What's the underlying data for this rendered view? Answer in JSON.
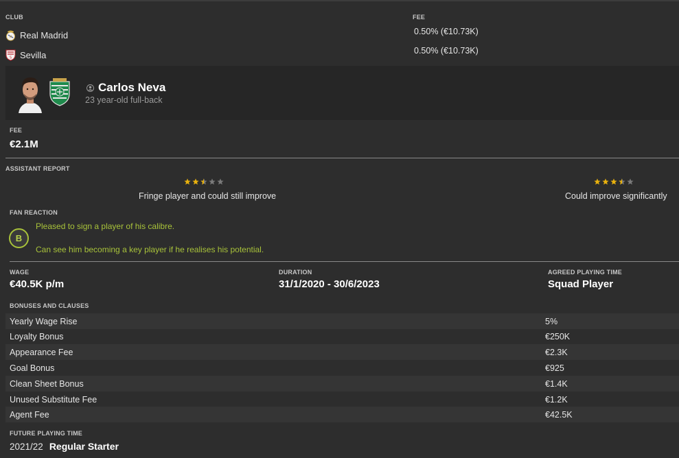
{
  "clubs_section": {
    "club_label": "CLUB",
    "fee_label": "FEE",
    "rows": [
      {
        "club": "Real Madrid",
        "fee": "0.50% (€10.73K)"
      },
      {
        "club": "Sevilla",
        "fee": "0.50% (€10.73K)"
      }
    ]
  },
  "player": {
    "name": "Carlos Neva",
    "description": "23 year-old full-back"
  },
  "fee": {
    "label": "FEE",
    "value": "€2.1M"
  },
  "assistant_report": {
    "label": "ASSISTANT REPORT",
    "current": {
      "stars": 2.5,
      "text": "Fringe player and could still improve"
    },
    "potential": {
      "stars": 3.5,
      "text": "Could improve significantly"
    }
  },
  "fan_reaction": {
    "label": "FAN REACTION",
    "grade": "B",
    "lines": [
      "Pleased to sign a player of his calibre.",
      "Can see him becoming a key player if he realises his potential."
    ]
  },
  "contract": {
    "wage_label": "WAGE",
    "wage": "€40.5K p/m",
    "duration_label": "DURATION",
    "duration": "31/1/2020 - 30/6/2023",
    "playing_time_label": "AGREED PLAYING TIME",
    "playing_time": "Squad Player"
  },
  "bonuses": {
    "label": "BONUSES AND CLAUSES",
    "rows": [
      {
        "name": "Yearly Wage Rise",
        "value": "5%"
      },
      {
        "name": "Loyalty Bonus",
        "value": "€250K"
      },
      {
        "name": "Appearance Fee",
        "value": "€2.3K"
      },
      {
        "name": "Goal Bonus",
        "value": "€925"
      },
      {
        "name": "Clean Sheet Bonus",
        "value": "€1.4K"
      },
      {
        "name": "Unused Substitute Fee",
        "value": "€1.2K"
      },
      {
        "name": "Agent Fee",
        "value": "€42.5K"
      }
    ]
  },
  "future_playing_time": {
    "label": "FUTURE PLAYING TIME",
    "season": "2021/22",
    "role": "Regular Starter"
  },
  "colors": {
    "background": "#2d2d2d",
    "card": "#262626",
    "star_on": "#e8b10e",
    "star_off": "#7a7a7a",
    "fan_accent": "#a8c23a"
  }
}
